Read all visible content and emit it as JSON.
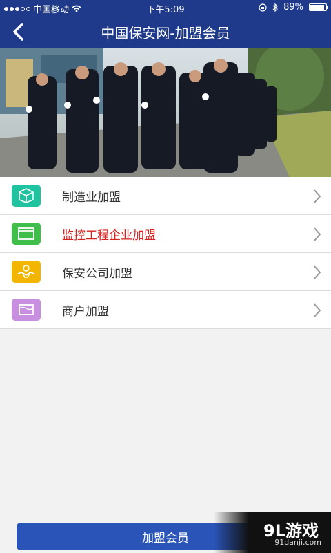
{
  "status": {
    "carrier": "中国移动",
    "time": "下午5:09",
    "battery": "89%",
    "battery_level": 0.89
  },
  "nav": {
    "title": "中国保安网-加盟会员"
  },
  "menu": [
    {
      "label": "制造业加盟",
      "icon": "box-icon",
      "icon_color": "#1fc3a0",
      "text_color": "#333333"
    },
    {
      "label": "监控工程企业加盟",
      "icon": "monitor-window-icon",
      "icon_color": "#3fbf4a",
      "text_color": "#d8221f"
    },
    {
      "label": "保安公司加盟",
      "icon": "handshake-icon",
      "icon_color": "#f2b600",
      "text_color": "#333333"
    },
    {
      "label": "商户加盟",
      "icon": "storefront-icon",
      "icon_color": "#c88ee0",
      "text_color": "#333333"
    }
  ],
  "bottom_button": "加盟会员",
  "watermark": {
    "brand": "9L游戏",
    "url": "91danji.com"
  }
}
